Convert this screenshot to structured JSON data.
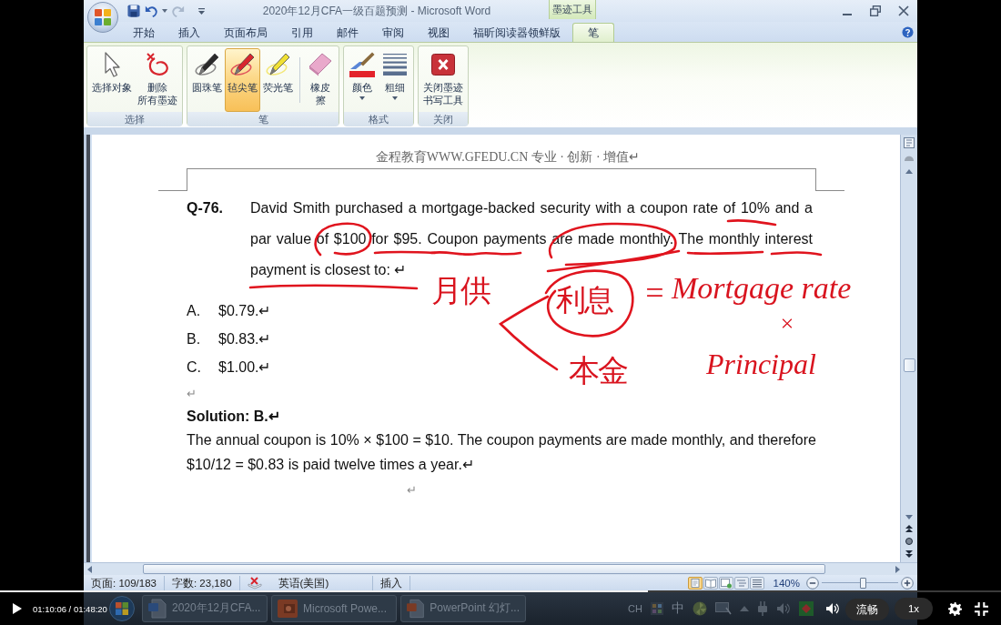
{
  "window": {
    "title": "2020年12月CFA一级百题预测 - Microsoft Word",
    "tool_group": "墨迹工具"
  },
  "ribbon_tabs": [
    {
      "label": "开始",
      "selected": false
    },
    {
      "label": "插入",
      "selected": false
    },
    {
      "label": "页面布局",
      "selected": false
    },
    {
      "label": "引用",
      "selected": false
    },
    {
      "label": "邮件",
      "selected": false
    },
    {
      "label": "审阅",
      "selected": false
    },
    {
      "label": "视图",
      "selected": false
    },
    {
      "label": "福昕阅读器领鲜版",
      "selected": false
    },
    {
      "label": "笔",
      "selected": true
    }
  ],
  "ribbon_groups": [
    {
      "label": "选择",
      "items": [
        {
          "label": "选择对象",
          "kind": "pointer",
          "selected": false,
          "dropdown": false
        },
        {
          "label": "删除所有墨迹",
          "kind": "delete-ink",
          "selected": false,
          "dropdown": false
        }
      ]
    },
    {
      "label": "笔",
      "items": [
        {
          "label": "圆珠笔",
          "kind": "ballpoint",
          "selected": false,
          "dropdown": false
        },
        {
          "label": "毡尖笔",
          "kind": "felt-tip",
          "selected": true,
          "dropdown": false
        },
        {
          "label": "荧光笔",
          "kind": "highlighter",
          "selected": false,
          "dropdown": false
        },
        {
          "label": "橡皮擦",
          "kind": "eraser",
          "selected": false,
          "dropdown": false
        }
      ]
    },
    {
      "label": "格式",
      "items": [
        {
          "label": "颜色",
          "kind": "color",
          "selected": false,
          "dropdown": true
        },
        {
          "label": "粗细",
          "kind": "weight",
          "selected": false,
          "dropdown": true
        }
      ]
    },
    {
      "label": "关闭",
      "items": [
        {
          "label": "关闭墨迹书写工具",
          "kind": "close-ink",
          "selected": false,
          "dropdown": false
        }
      ]
    }
  ],
  "document": {
    "header": "金程教育WWW.GFEDU.CN 专业 · 创新 · 增值↵",
    "question": {
      "number": "Q-76.",
      "text": "David Smith purchased a mortgage-backed security with a coupon rate of 10% and a par value of $100 for $95. Coupon payments are made monthly. The monthly interest payment is closest to: ↵"
    },
    "options": [
      {
        "letter": "A.",
        "text": "$0.79.↵"
      },
      {
        "letter": "B.",
        "text": "$0.83.↵"
      },
      {
        "letter": "C.",
        "text": "$1.00.↵"
      }
    ],
    "blank_mark": "↵",
    "solution_heading": "Solution: B.↵",
    "solution_text": "The annual coupon is 10% × $100 = $10. The coupon payments are made monthly, and therefore $10/12 = $0.83 is paid twelve times a year.↵",
    "trailing_mark": "↵"
  },
  "ink_notes": [
    {
      "text": "月供"
    },
    {
      "text": "利息"
    },
    {
      "text": "="
    },
    {
      "text": "Mortgage rate"
    },
    {
      "text": "×"
    },
    {
      "text": "本金"
    },
    {
      "text": "Principal"
    }
  ],
  "status_bar": {
    "page": "页面: 109/183",
    "word_count": "字数: 23,180",
    "language": "英语(美国)",
    "mode": "插入",
    "view_buttons": [
      {
        "kind": "print-layout",
        "selected": true
      },
      {
        "kind": "reading",
        "selected": false
      },
      {
        "kind": "web-layout",
        "selected": false
      },
      {
        "kind": "outline",
        "selected": false
      },
      {
        "kind": "draft",
        "selected": false
      }
    ],
    "zoom": "140%",
    "zoom_slider": {
      "level": 0.53
    }
  },
  "taskbar": {
    "items": [
      {
        "label": "2020年12月CFA...",
        "kind": "word"
      },
      {
        "label": "Microsoft Powe...",
        "kind": "powerpoint"
      },
      {
        "label": "PowerPoint 幻灯...",
        "kind": "powerpoint-doc"
      }
    ],
    "tray_language": "CH",
    "tray_ime": "中"
  },
  "video_player": {
    "progress": {
      "level": 0.647
    },
    "time": "01:10:06 / 01:48:20",
    "quality": "流畅",
    "speed": "1x"
  }
}
